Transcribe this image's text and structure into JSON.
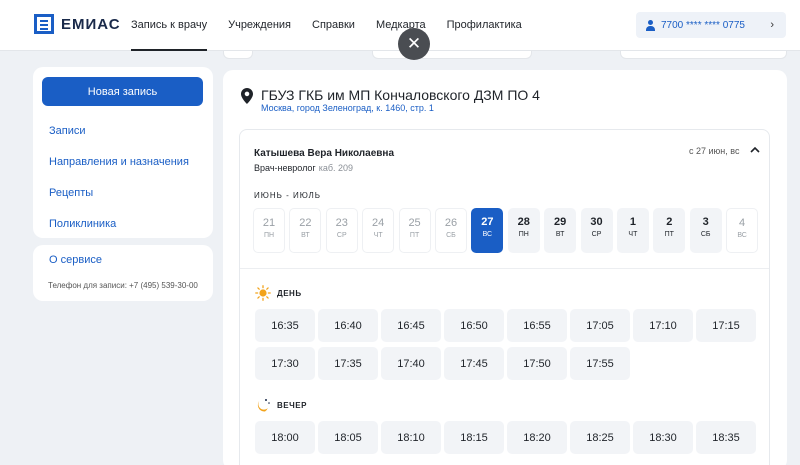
{
  "header": {
    "logo_text": "ЕМИАС",
    "nav": [
      "Запись к врачу",
      "Учреждения",
      "Справки",
      "Медкарта",
      "Профилактика"
    ],
    "active_nav": 0,
    "user_phone": "7700 **** **** 0775"
  },
  "sidebar": {
    "new_button": "Новая запись",
    "items": [
      "Записи",
      "Направления и назначения",
      "Рецепты",
      "Поликлиника"
    ],
    "about": "О сервисе",
    "phone_note": "Телефон для записи: +7 (495) 539-30-00"
  },
  "clinic": {
    "name": "ГБУЗ ГКБ им МП Кончаловского ДЗМ ПО 4",
    "address": "Москва, город Зеленоград, к. 1460, стр. 1"
  },
  "doctor": {
    "name": "Катышева Вера Николаевна",
    "specialty": "Врач-невролог",
    "room": "каб. 209",
    "from_date": "с 27 июн, вс"
  },
  "calendar": {
    "month_label": "ИЮНЬ - ИЮЛЬ",
    "days": [
      {
        "num": "21",
        "wd": "ПН",
        "state": "past"
      },
      {
        "num": "22",
        "wd": "ВТ",
        "state": "past"
      },
      {
        "num": "23",
        "wd": "СР",
        "state": "past"
      },
      {
        "num": "24",
        "wd": "ЧТ",
        "state": "past"
      },
      {
        "num": "25",
        "wd": "ПТ",
        "state": "past"
      },
      {
        "num": "26",
        "wd": "СБ",
        "state": "past"
      },
      {
        "num": "27",
        "wd": "ВС",
        "state": "selected"
      },
      {
        "num": "28",
        "wd": "ПН",
        "state": "avail"
      },
      {
        "num": "29",
        "wd": "ВТ",
        "state": "avail"
      },
      {
        "num": "30",
        "wd": "СР",
        "state": "avail"
      },
      {
        "num": "1",
        "wd": "ЧТ",
        "state": "avail"
      },
      {
        "num": "2",
        "wd": "ПТ",
        "state": "avail"
      },
      {
        "num": "3",
        "wd": "СБ",
        "state": "avail"
      },
      {
        "num": "4",
        "wd": "ВС",
        "state": "off"
      }
    ]
  },
  "periods": {
    "day": {
      "label": "ДЕНЬ",
      "slots": [
        "16:35",
        "16:40",
        "16:45",
        "16:50",
        "16:55",
        "17:05",
        "17:10",
        "17:15",
        "17:30",
        "17:35",
        "17:40",
        "17:45",
        "17:50",
        "17:55"
      ]
    },
    "evening": {
      "label": "ВЕЧЕР",
      "slots": [
        "18:00",
        "18:05",
        "18:10",
        "18:15",
        "18:20",
        "18:25",
        "18:30",
        "18:35"
      ]
    }
  },
  "colors": {
    "accent": "#1a5ec5",
    "sun": "#f2a31b",
    "moon": "#f2a31b"
  }
}
